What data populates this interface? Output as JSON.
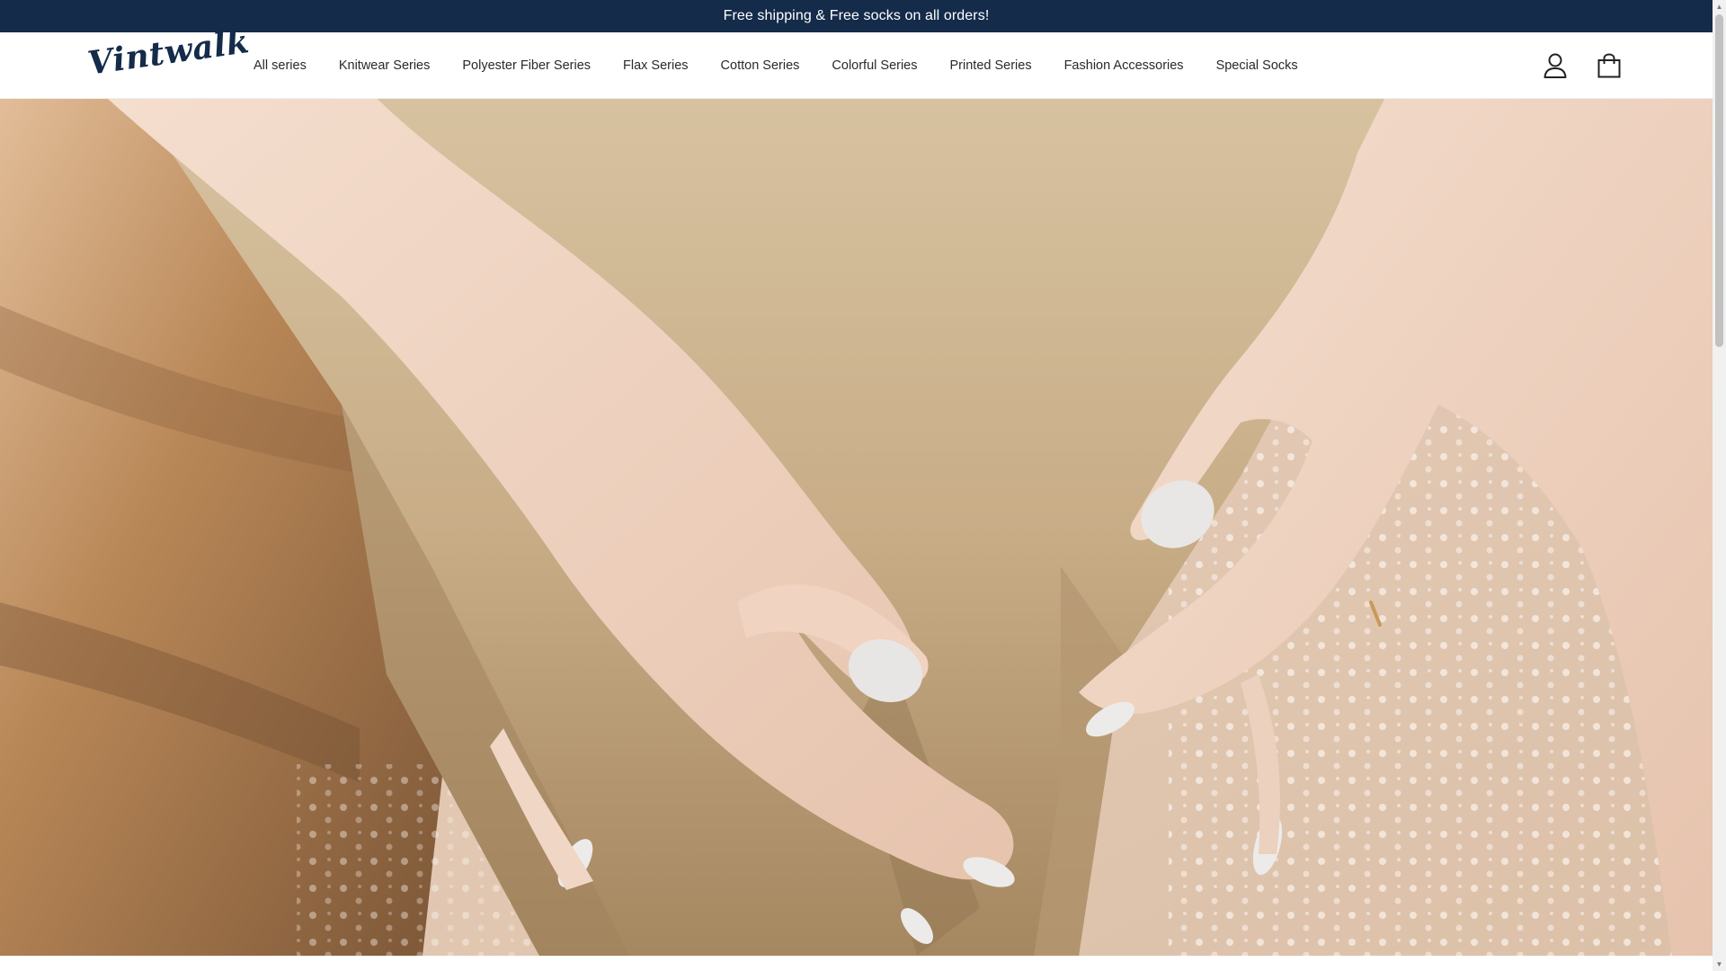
{
  "announcement": {
    "text": "Free shipping & Free socks on all orders!"
  },
  "header": {
    "logo_text": "Vintwalk",
    "nav": [
      {
        "label": "All series"
      },
      {
        "label": "Knitwear Series"
      },
      {
        "label": "Polyester Fiber Series"
      },
      {
        "label": "Flax Series"
      },
      {
        "label": "Cotton Series"
      },
      {
        "label": "Colorful Series"
      },
      {
        "label": "Printed Series"
      },
      {
        "label": "Fashion Accessories"
      },
      {
        "label": "Special Socks"
      }
    ],
    "icons": {
      "account": "user-icon",
      "cart": "shopping-bag-icon"
    }
  },
  "colors": {
    "brand_navy": "#142b4a",
    "hero_paper": "#c9ad86",
    "hero_skin": "#f1d9c8"
  }
}
